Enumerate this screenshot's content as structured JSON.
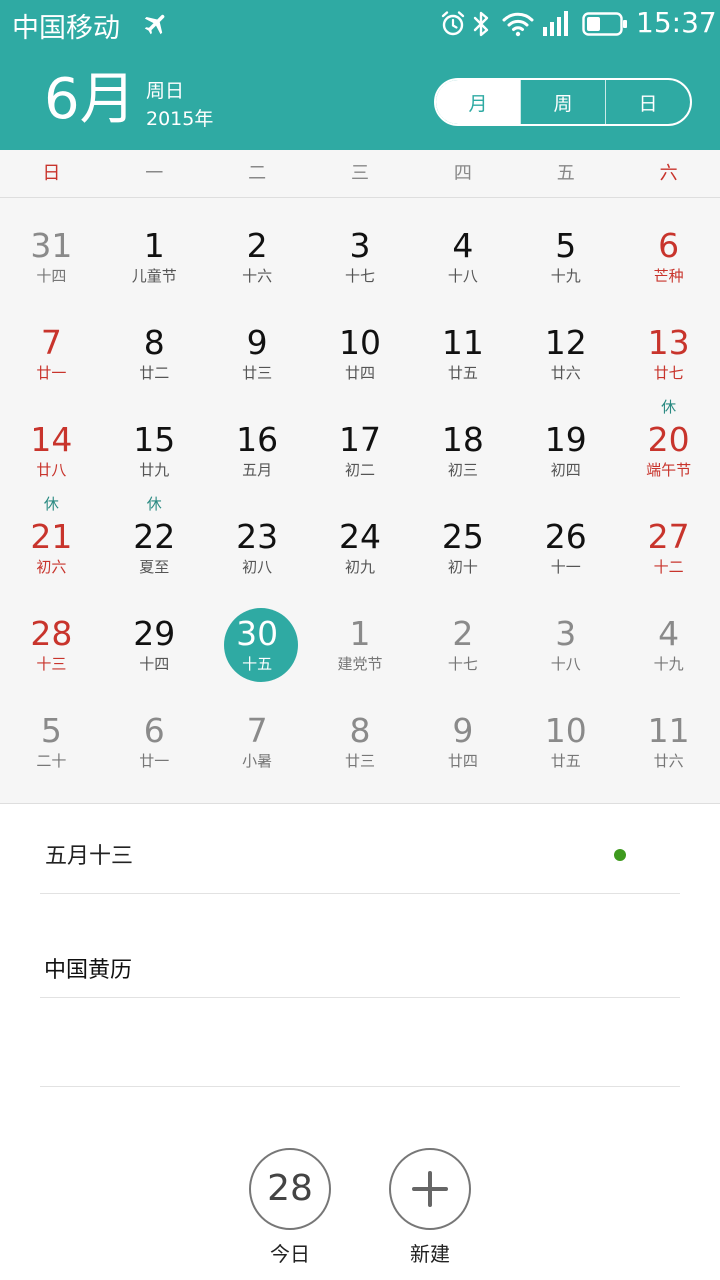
{
  "status_bar": {
    "carrier": "中国移动",
    "time": "15:37",
    "icons": [
      "airplane-icon",
      "alarm-icon",
      "bluetooth-icon",
      "wifi-icon",
      "signal-icon",
      "battery-icon"
    ]
  },
  "header": {
    "month": "6月",
    "weekday": "周日",
    "year": "2015年",
    "view_tabs": [
      {
        "label": "月",
        "active": true
      },
      {
        "label": "周",
        "active": false
      },
      {
        "label": "日",
        "active": false
      }
    ],
    "accent_color": "#2faaa3"
  },
  "weekdays": [
    "日",
    "一",
    "二",
    "三",
    "四",
    "五",
    "六"
  ],
  "calendar": {
    "weekend_color": "#c8342c",
    "weeks": [
      [
        {
          "day": "31",
          "lunar": "十四",
          "type": "grey"
        },
        {
          "day": "1",
          "lunar": "儿童节",
          "type": "normal"
        },
        {
          "day": "2",
          "lunar": "十六",
          "type": "normal"
        },
        {
          "day": "3",
          "lunar": "十七",
          "type": "normal"
        },
        {
          "day": "4",
          "lunar": "十八",
          "type": "normal"
        },
        {
          "day": "5",
          "lunar": "十九",
          "type": "normal"
        },
        {
          "day": "6",
          "lunar": "芒种",
          "type": "red"
        }
      ],
      [
        {
          "day": "7",
          "lunar": "廿一",
          "type": "red"
        },
        {
          "day": "8",
          "lunar": "廿二",
          "type": "normal"
        },
        {
          "day": "9",
          "lunar": "廿三",
          "type": "normal"
        },
        {
          "day": "10",
          "lunar": "廿四",
          "type": "normal"
        },
        {
          "day": "11",
          "lunar": "廿五",
          "type": "normal"
        },
        {
          "day": "12",
          "lunar": "廿六",
          "type": "normal"
        },
        {
          "day": "13",
          "lunar": "廿七",
          "type": "red"
        }
      ],
      [
        {
          "day": "14",
          "lunar": "廿八",
          "type": "red"
        },
        {
          "day": "15",
          "lunar": "廿九",
          "type": "normal"
        },
        {
          "day": "16",
          "lunar": "五月",
          "type": "normal"
        },
        {
          "day": "17",
          "lunar": "初二",
          "type": "normal"
        },
        {
          "day": "18",
          "lunar": "初三",
          "type": "normal"
        },
        {
          "day": "19",
          "lunar": "初四",
          "type": "normal"
        },
        {
          "day": "20",
          "lunar": "端午节",
          "type": "red",
          "mark": "休"
        }
      ],
      [
        {
          "day": "21",
          "lunar": "初六",
          "type": "red",
          "mark": "休"
        },
        {
          "day": "22",
          "lunar": "夏至",
          "type": "normal",
          "mark": "休"
        },
        {
          "day": "23",
          "lunar": "初八",
          "type": "normal"
        },
        {
          "day": "24",
          "lunar": "初九",
          "type": "normal"
        },
        {
          "day": "25",
          "lunar": "初十",
          "type": "normal"
        },
        {
          "day": "26",
          "lunar": "十一",
          "type": "normal"
        },
        {
          "day": "27",
          "lunar": "十二",
          "type": "red"
        }
      ],
      [
        {
          "day": "28",
          "lunar": "十三",
          "type": "red"
        },
        {
          "day": "29",
          "lunar": "十四",
          "type": "normal"
        },
        {
          "day": "30",
          "lunar": "十五",
          "type": "selected"
        },
        {
          "day": "1",
          "lunar": "建党节",
          "type": "grey"
        },
        {
          "day": "2",
          "lunar": "十七",
          "type": "grey"
        },
        {
          "day": "3",
          "lunar": "十八",
          "type": "grey"
        },
        {
          "day": "4",
          "lunar": "十九",
          "type": "grey"
        }
      ],
      [
        {
          "day": "5",
          "lunar": "二十",
          "type": "grey"
        },
        {
          "day": "6",
          "lunar": "廿一",
          "type": "grey"
        },
        {
          "day": "7",
          "lunar": "小暑",
          "type": "grey"
        },
        {
          "day": "8",
          "lunar": "廿三",
          "type": "grey"
        },
        {
          "day": "9",
          "lunar": "廿四",
          "type": "grey"
        },
        {
          "day": "10",
          "lunar": "廿五",
          "type": "grey"
        },
        {
          "day": "11",
          "lunar": "廿六",
          "type": "grey"
        }
      ]
    ]
  },
  "detail": {
    "lunar_date": "五月十三",
    "event_dot_color": "#3e9a1e",
    "almanac": "中国黄历"
  },
  "bottom_bar": {
    "today_number": "28",
    "today_label": "今日",
    "new_label": "新建"
  }
}
